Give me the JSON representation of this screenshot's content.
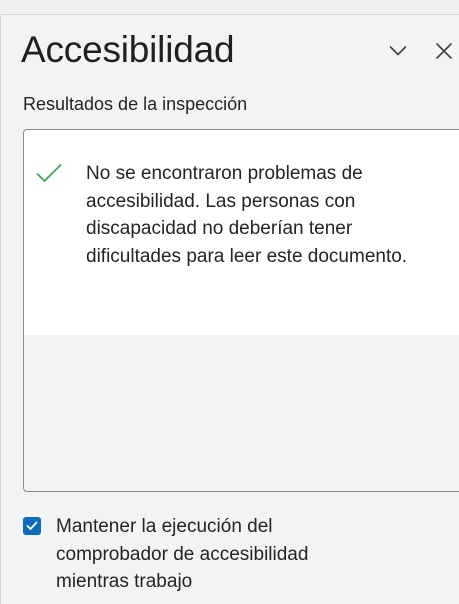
{
  "pane": {
    "title": "Accesibilidad",
    "chevron_icon": "chevron-down-icon",
    "close_icon": "close-icon"
  },
  "inspection": {
    "section_label": "Resultados de la inspección",
    "result_icon": "checkmark-icon",
    "result_text": "No se encontraron problemas de accesibilidad. Las personas con discapacidad no deberían tener dificultades para leer este documento.",
    "result_icon_color": "#3aa655"
  },
  "keep_running": {
    "checked": true,
    "label": "Mantener la ejecución del comprobador de accesibilidad mientras trabajo",
    "checkbox_color": "#0f6cbd"
  }
}
